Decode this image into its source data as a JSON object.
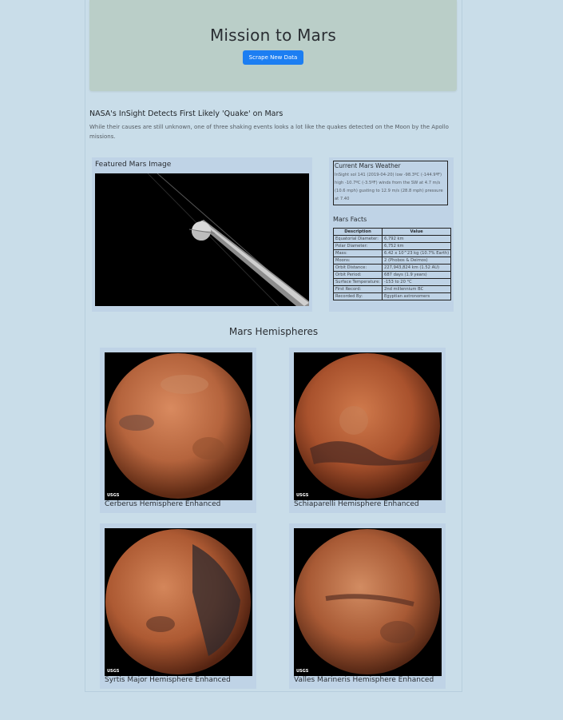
{
  "header": {
    "title": "Mission to Mars",
    "scrape_button_label": "Scrape New Data"
  },
  "news": {
    "title": "NASA's InSight Detects First Likely 'Quake' on Mars",
    "paragraph": "While their causes are still unknown, one of three shaking events looks a lot like the quakes detected on the Moon by the Apollo missions."
  },
  "featured": {
    "label": "Featured Mars Image"
  },
  "weather": {
    "title": "Current Mars Weather",
    "text": "InSight sol 141 (2019-04-20) low -98.3ºC (-144.9ºF) high -10.7ºC (-3.5ºF) winds from the SW at 4.7 m/s (10.6 mph) gusting to 12.9 m/s (28.8 mph) pressure at 7.40"
  },
  "facts": {
    "title": "Mars Facts",
    "headers": [
      "Description",
      "Value"
    ],
    "rows": [
      [
        "Equatorial Diameter:",
        "6,792 km"
      ],
      [
        "Polar Diameter:",
        "6,752 km"
      ],
      [
        "Mass:",
        "6.42 x 10^23 kg (10.7% Earth)"
      ],
      [
        "Moons:",
        "2 (Phobos & Deimos)"
      ],
      [
        "Orbit Distance:",
        "227,943,824 km (1.52 AU)"
      ],
      [
        "Orbit Period:",
        "687 days (1.9 years)"
      ],
      [
        "Surface Temperature:",
        "-153 to 20 °C"
      ],
      [
        "First Record:",
        "2nd millennium BC"
      ],
      [
        "Recorded By:",
        "Egyptian astronomers"
      ]
    ]
  },
  "hemispheres": {
    "heading": "Mars Hemispheres",
    "items": [
      {
        "title": "Cerberus Hemisphere Enhanced",
        "logo": "USGS"
      },
      {
        "title": "Schiaparelli Hemisphere Enhanced",
        "logo": "USGS"
      },
      {
        "title": "Syrtis Major Hemisphere Enhanced",
        "logo": "USGS"
      },
      {
        "title": "Valles Marineris Hemisphere Enhanced",
        "logo": "USGS"
      }
    ]
  }
}
